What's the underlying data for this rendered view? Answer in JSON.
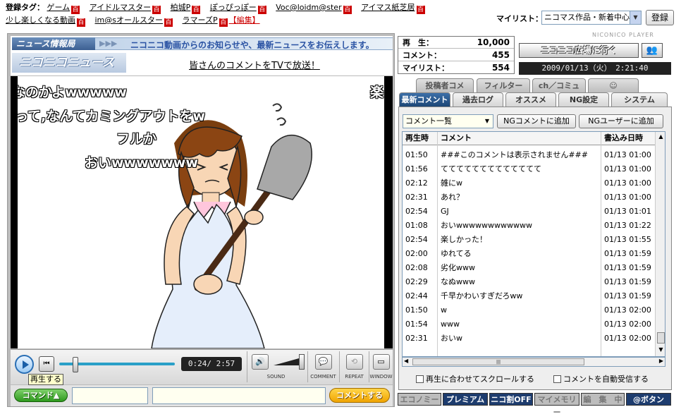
{
  "tags": {
    "label": "登録タグ：",
    "items": [
      "ゲーム",
      "アイドルマスター",
      "柏城P",
      "ぽっぴっぽー",
      "Voc@loidm@ster",
      "アイマス紙芝居",
      "少し楽しくなる動画",
      "im@sオールスター",
      "ラマーズP"
    ],
    "badge": "百",
    "edit": "【編集】"
  },
  "mylist": {
    "label": "マイリスト：",
    "selected": "ニコマス作品・新着中心",
    "login": "登録"
  },
  "brand": "NICONICO PLAYER",
  "news": {
    "logo_top": "ニュース情報局",
    "strip_text": "ニコニコ動画からのお知らせや、最新ニュースをお伝えします。",
    "logo_main": "ニコニコニュース",
    "link": "皆さんのコメントをTVで放送！"
  },
  "overlay_comments": [
    "なのかよwwwww",
    "楽し",
    "って,なんてカミングアウトをw",
    "フルか",
    "おいwwwwwww"
  ],
  "player": {
    "time": "0:24/ 2:57",
    "tooltip": "再生する",
    "controls": [
      "SOUND",
      "COMMENT",
      "REPEAT",
      "WINDOW"
    ],
    "command_btn": "コマンド▲",
    "submit_btn": "コメントする"
  },
  "stats": {
    "play_label": "再　生：",
    "play": "10,000",
    "comment_label": "コメント：",
    "comment": "455",
    "mylist_label": "マイリスト：",
    "mylist": "554"
  },
  "hiroba": "ニコニコ広場に行く",
  "clock": "2009/01/13（火）　2:21:40",
  "tabs_back": [
    "投稿者コメ",
    "フィルター",
    "ch／コミュ"
  ],
  "tabs_front": [
    "最新コメント",
    "過去ログ",
    "オススメ",
    "NG設定",
    "システム"
  ],
  "filter": {
    "selected": "コメント一覧",
    "ng_comment": "NGコメントに追加",
    "ng_user": "NGユーザーに追加"
  },
  "list_headers": [
    "再生時",
    "コメント",
    "書込み日時"
  ],
  "comments": [
    {
      "t": "01:50",
      "c": "###このコメントは表示されません###",
      "d": "01/13 01:00"
    },
    {
      "t": "01:56",
      "c": "ててててててててててててて",
      "d": "01/13 01:00"
    },
    {
      "t": "02:12",
      "c": "雑にw",
      "d": "01/13 01:00"
    },
    {
      "t": "02:31",
      "c": "あれ？",
      "d": "01/13 01:00"
    },
    {
      "t": "02:54",
      "c": "GJ",
      "d": "01/13 01:01"
    },
    {
      "t": "01:08",
      "c": "おいwwwwwwwwwwww",
      "d": "01/13 01:22"
    },
    {
      "t": "02:54",
      "c": "楽しかった！",
      "d": "01/13 01:55"
    },
    {
      "t": "02:00",
      "c": "ゆれてる",
      "d": "01/13 01:59"
    },
    {
      "t": "02:08",
      "c": "劣化www",
      "d": "01/13 01:59"
    },
    {
      "t": "02:29",
      "c": "なぬwww",
      "d": "01/13 01:59"
    },
    {
      "t": "02:44",
      "c": "千早かわいすぎだろww",
      "d": "01/13 01:59"
    },
    {
      "t": "01:50",
      "c": "w",
      "d": "01/13 02:00"
    },
    {
      "t": "01:54",
      "c": "www",
      "d": "01/13 02:00"
    },
    {
      "t": "02:31",
      "c": "おいw",
      "d": "01/13 02:00"
    }
  ],
  "checks": {
    "scroll": "再生に合わせてスクロールする",
    "auto": "コメントを自動受信する"
  },
  "bottom_buttons": [
    "エコノミー",
    "プレミアム",
    "ニコ割OFF",
    "マイメモリー",
    "編　集　中",
    "@ボタン"
  ]
}
